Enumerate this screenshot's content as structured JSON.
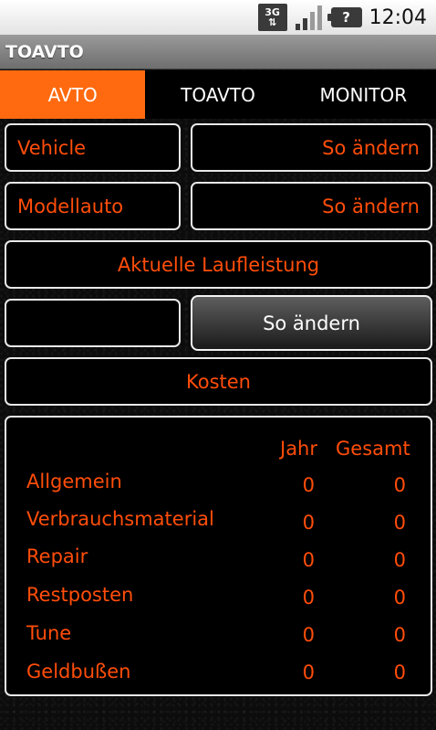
{
  "status_bar": {
    "network": "3G",
    "clock": "12:04",
    "icons": [
      "network-3g-icon",
      "signal-icon",
      "battery-unknown-icon"
    ]
  },
  "title_bar": {
    "title": "TOAVTO"
  },
  "tabs": [
    {
      "label": "AVTO",
      "active": true
    },
    {
      "label": "TOAVTO",
      "active": false
    },
    {
      "label": "MONITOR",
      "active": false
    }
  ],
  "rows": {
    "vehicle": {
      "label": "Vehicle",
      "action": "So ändern"
    },
    "model": {
      "label": "Modellauto",
      "action": "So ändern"
    },
    "mileage": {
      "label": "Aktuelle Laufleistung",
      "value": "",
      "action": "So ändern"
    },
    "costs_header": "Kosten"
  },
  "costs": {
    "columns": [
      "Jahr",
      "Gesamt"
    ],
    "rows": [
      {
        "label": "Allgemein",
        "jahr": "0",
        "gesamt": "0"
      },
      {
        "label": "Verbrauchsmaterial",
        "jahr": "0",
        "gesamt": "0"
      },
      {
        "label": "Repair",
        "jahr": "0",
        "gesamt": "0"
      },
      {
        "label": "Restposten",
        "jahr": "0",
        "gesamt": "0"
      },
      {
        "label": "Tune",
        "jahr": "0",
        "gesamt": "0"
      },
      {
        "label": "Geldbußen",
        "jahr": "0",
        "gesamt": "0"
      }
    ]
  },
  "colors": {
    "accent": "#ff6a10",
    "text": "#ff4d0a",
    "border": "#e8e8e8"
  }
}
